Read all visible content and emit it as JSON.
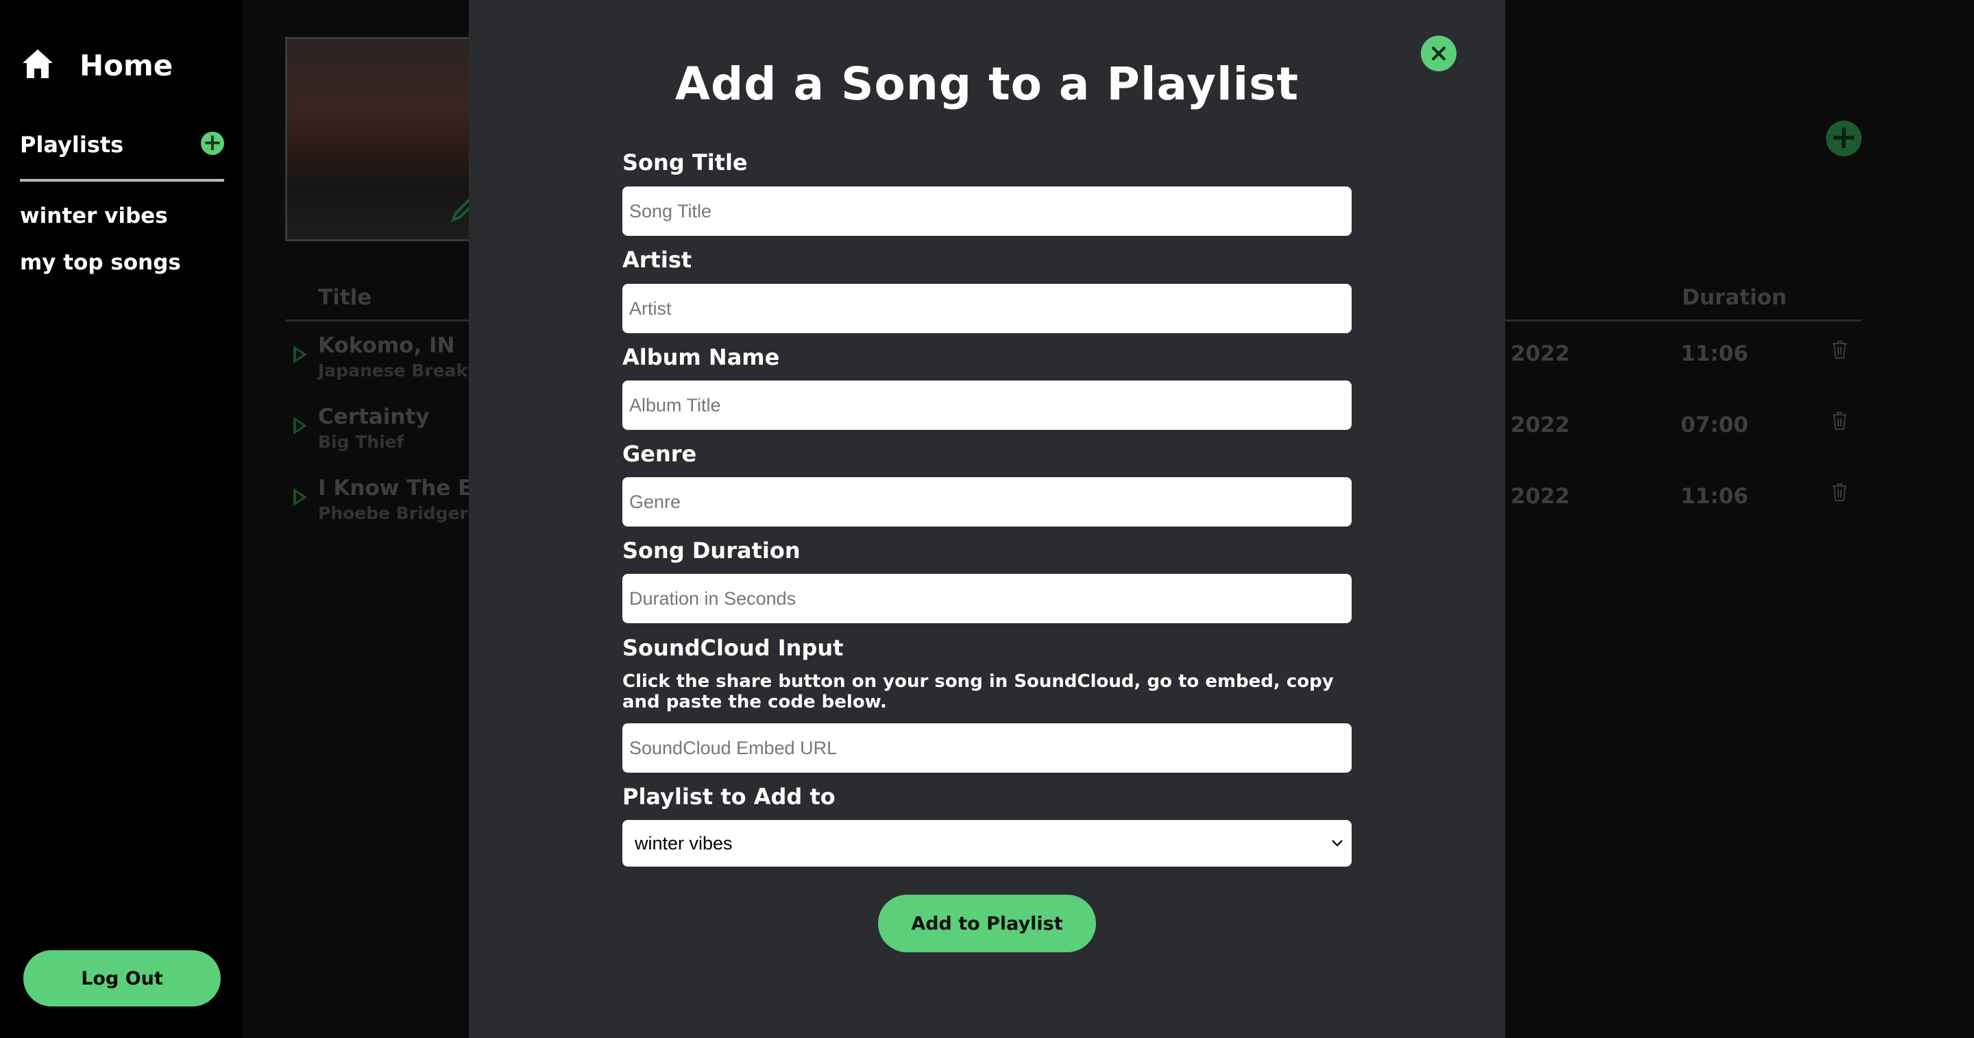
{
  "sidebar": {
    "home_label": "Home",
    "playlists_label": "Playlists",
    "add_playlist_symbol": "+",
    "playlists": [
      {
        "label": "winter vibes"
      },
      {
        "label": "my top songs"
      }
    ],
    "logout_label": "Log Out"
  },
  "main": {
    "add_symbol": "+",
    "columns": {
      "title": "Title",
      "duration": "Duration"
    },
    "songs": [
      {
        "title": "Kokomo, IN",
        "artist": "Japanese Breakf",
        "year": "2022",
        "duration": "11:06"
      },
      {
        "title": "Certainty",
        "artist": "Big Thief",
        "year": "2022",
        "duration": "07:00"
      },
      {
        "title": "I Know The En",
        "artist": "Phoebe Bridgers",
        "year": "2022",
        "duration": "11:06"
      }
    ]
  },
  "modal": {
    "title": "Add a Song to a Playlist",
    "fields": {
      "song_title": {
        "label": "Song Title",
        "placeholder": "Song Title",
        "value": ""
      },
      "artist": {
        "label": "Artist",
        "placeholder": "Artist",
        "value": ""
      },
      "album": {
        "label": "Album Name",
        "placeholder": "Album Title",
        "value": ""
      },
      "genre": {
        "label": "Genre",
        "placeholder": "Genre",
        "value": ""
      },
      "duration": {
        "label": "Song Duration",
        "placeholder": "Duration in Seconds",
        "value": ""
      },
      "soundcloud": {
        "label": "SoundCloud Input",
        "hint": "Click the share button on your song in SoundCloud, go to embed, copy and paste the code below.",
        "placeholder": "SoundCloud Embed URL",
        "value": ""
      },
      "playlist": {
        "label": "Playlist to Add to",
        "selected": "winter vibes"
      }
    },
    "submit_label": "Add to Playlist"
  },
  "icons": {
    "home": "home-icon",
    "close": "close-icon",
    "play": "play-icon",
    "trash": "trash-icon",
    "pencil": "pencil-icon",
    "caret": "chevron-down-icon"
  },
  "colors": {
    "accent": "#5ccf7a",
    "modal_bg": "#2a2c30",
    "page_bg": "#000000"
  }
}
